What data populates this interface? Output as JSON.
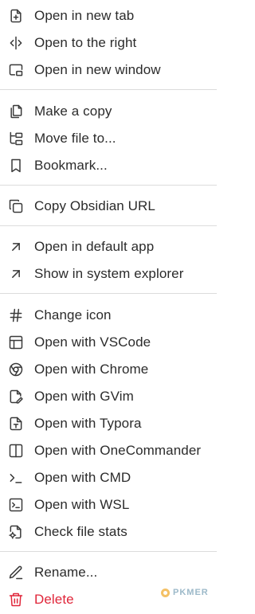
{
  "menu": {
    "items": [
      {
        "label": "Open in new tab",
        "icon": "file-plus-icon"
      },
      {
        "label": "Open to the right",
        "icon": "split-vertical-icon"
      },
      {
        "label": "Open in new window",
        "icon": "picture-in-picture-icon"
      },
      {
        "label": "Make a copy",
        "icon": "copy-file-icon"
      },
      {
        "label": "Move file to...",
        "icon": "folder-tree-icon"
      },
      {
        "label": "Bookmark...",
        "icon": "bookmark-icon"
      },
      {
        "label": "Copy Obsidian URL",
        "icon": "copy-icon"
      },
      {
        "label": "Open in default app",
        "icon": "arrow-up-right-icon"
      },
      {
        "label": "Show in system explorer",
        "icon": "arrow-up-right-icon"
      },
      {
        "label": "Change icon",
        "icon": "hash-icon"
      },
      {
        "label": "Open with VSCode",
        "icon": "layout-icon"
      },
      {
        "label": "Open with Chrome",
        "icon": "chrome-icon"
      },
      {
        "label": "Open with GVim",
        "icon": "file-pen-icon"
      },
      {
        "label": "Open with Typora",
        "icon": "file-type-icon"
      },
      {
        "label": "Open with OneCommander",
        "icon": "columns-icon"
      },
      {
        "label": "Open with CMD",
        "icon": "terminal-icon"
      },
      {
        "label": "Open with WSL",
        "icon": "terminal-square-icon"
      },
      {
        "label": "Check file stats",
        "icon": "file-cog-icon"
      },
      {
        "label": "Rename...",
        "icon": "pencil-icon"
      },
      {
        "label": "Delete",
        "icon": "trash-icon"
      }
    ]
  },
  "watermark": {
    "text": "PKMER"
  },
  "colors": {
    "text": "#2b2b2b",
    "danger": "#e0263a",
    "separator": "#dcdcdc"
  }
}
